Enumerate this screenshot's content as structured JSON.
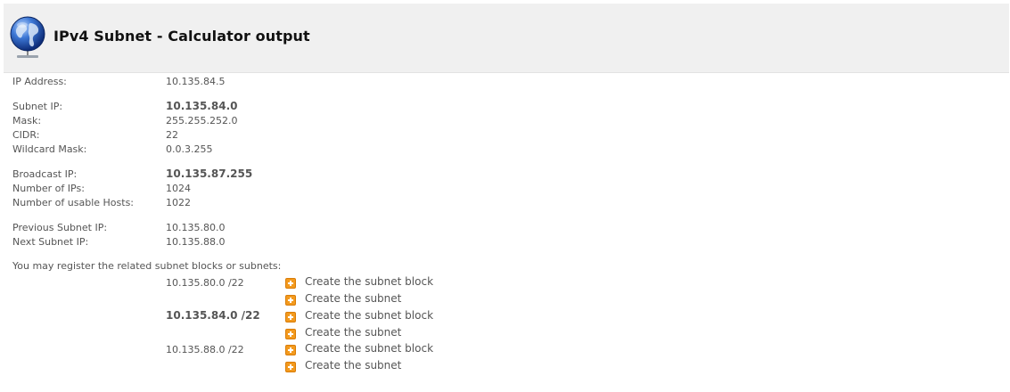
{
  "header": {
    "title": "IPv4 Subnet - Calculator output",
    "icon": "globe-network-icon"
  },
  "fields": {
    "ip_address": {
      "label": "IP Address:",
      "value": "10.135.84.5"
    },
    "subnet_ip": {
      "label": "Subnet IP:",
      "value": "10.135.84.0"
    },
    "mask": {
      "label": "Mask:",
      "value": "255.255.252.0"
    },
    "cidr": {
      "label": "CIDR:",
      "value": "22"
    },
    "wildcard_mask": {
      "label": "Wildcard Mask:",
      "value": "0.0.3.255"
    },
    "broadcast_ip": {
      "label": "Broadcast IP:",
      "value": "10.135.87.255"
    },
    "number_of_ips": {
      "label": "Number of IPs:",
      "value": "1024"
    },
    "usable_hosts": {
      "label": "Number of usable Hosts:",
      "value": "1022"
    },
    "previous_subnet_ip": {
      "label": "Previous Subnet IP:",
      "value": "10.135.80.0"
    },
    "next_subnet_ip": {
      "label": "Next Subnet IP:",
      "value": "10.135.88.0"
    }
  },
  "register_note": "You may register the related subnet blocks or subnets:",
  "subnets": [
    {
      "block": "10.135.80.0 /22",
      "create_block": "Create the subnet block",
      "create_subnet": "Create the subnet"
    },
    {
      "block": "10.135.84.0 /22",
      "create_block": "Create the subnet block",
      "create_subnet": "Create the subnet"
    },
    {
      "block": "10.135.88.0 /22",
      "create_block": "Create the subnet block",
      "create_subnet": "Create the subnet"
    }
  ],
  "colors": {
    "header_bg": "#f0f0f0",
    "action_icon": "#f39a1e",
    "text": "#555555"
  }
}
